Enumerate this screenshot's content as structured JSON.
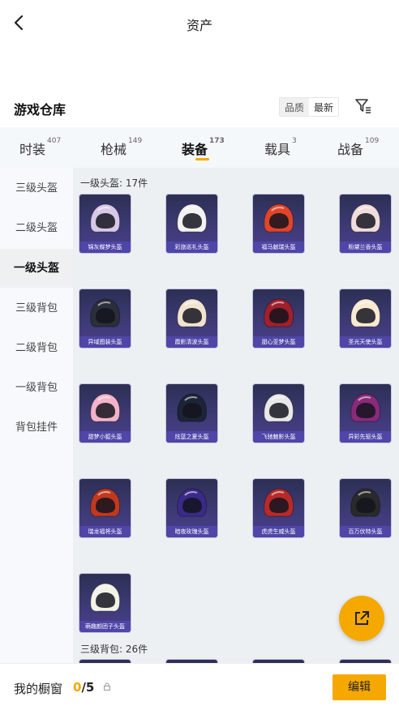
{
  "header": {
    "title": "资产",
    "back_icon": "chevron-left-icon"
  },
  "section": {
    "title": "游戏仓库",
    "sort_options": [
      "品质",
      "最新"
    ],
    "active_sort": "品质",
    "filter_icon": "filter-icon"
  },
  "tabs": [
    {
      "label": "时装",
      "count": "407"
    },
    {
      "label": "枪械",
      "count": "149"
    },
    {
      "label": "装备",
      "count": "173"
    },
    {
      "label": "载具",
      "count": "3"
    },
    {
      "label": "战备",
      "count": "109"
    }
  ],
  "active_tab": "装备",
  "sidebar": {
    "items": [
      "三级头盔",
      "二级头盔",
      "一级头盔",
      "三级背包",
      "二级背包",
      "一级背包",
      "背包挂件"
    ],
    "active": "一级头盔"
  },
  "groups": [
    {
      "label": "一级头盔: 17件"
    },
    {
      "label": "三级背包: 26件"
    }
  ],
  "items": [
    {
      "name": "锦灰蝶梦头盔",
      "color": "#d8c8e8"
    },
    {
      "name": "彩旅巡礼头盔",
      "color": "#f2f2f2"
    },
    {
      "name": "福马献瑞头盔",
      "color": "#e0442a"
    },
    {
      "name": "粉黛兰香头盔",
      "color": "#f1dcdc"
    },
    {
      "name": "异域图装头盔",
      "color": "#2a2f3a"
    },
    {
      "name": "霞影清波头盔",
      "color": "#f1e4cf"
    },
    {
      "name": "甜心亚梦头盔",
      "color": "#a0202c"
    },
    {
      "name": "圣光天使头盔",
      "color": "#f6ead2"
    },
    {
      "name": "甜梦小狐头盔",
      "color": "#f3b3c8"
    },
    {
      "name": "炫蓝之夏头盔",
      "color": "#1c2538"
    },
    {
      "name": "飞驰魅影头盔",
      "color": "#e8e8e8"
    },
    {
      "name": "异彩先驱头盔",
      "color": "#8a2a7a"
    },
    {
      "name": "瑞龙福将头盔",
      "color": "#c0391f"
    },
    {
      "name": "暗夜玫瑰头盔",
      "color": "#3b2a8a"
    },
    {
      "name": "虎虎生威头盔",
      "color": "#b82a2a"
    },
    {
      "name": "百万伏特头盔",
      "color": "#2a2a2a"
    },
    {
      "name": "萌趣颜团子头盔",
      "color": "#f2f2e6"
    }
  ],
  "display": {
    "label": "我的橱窗",
    "used": "0",
    "total": "/5"
  },
  "edit_button": "编辑",
  "fab_icon": "external-link-icon"
}
